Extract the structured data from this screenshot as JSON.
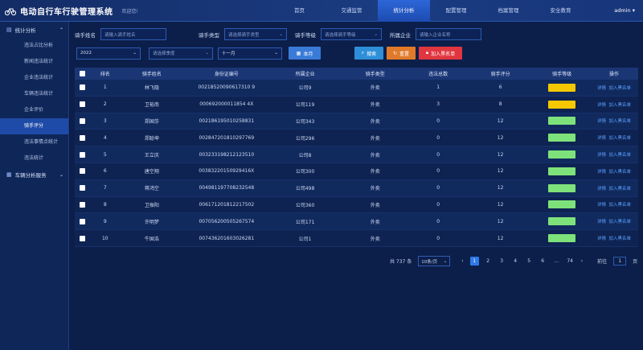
{
  "app": {
    "title": "电动自行车行驶管理系统",
    "welcome": "欢迎您!"
  },
  "nav": [
    "首页",
    "交通监管",
    "统计分析",
    "配置管理",
    "档案管理",
    "安全教育"
  ],
  "nav_active": 2,
  "user": "admin ▾",
  "sidebar": {
    "group1": "统计分析",
    "items": [
      "违法占比分析",
      "新闻违法统计",
      "企业违法统计",
      "车辆违法统计",
      "企业评价",
      "骑手评分",
      "违法事情点统计",
      "违法统计"
    ],
    "active_index": 5,
    "group2": "车辆分析服务"
  },
  "filters": {
    "rider_name_label": "骑手姓名",
    "rider_name_ph": "请输入骑手姓名",
    "rider_type_label": "骑手类型",
    "rider_type_ph": "请选择骑手类型",
    "rider_level_label": "骑手等级",
    "rider_level_ph": "请选择骑手等级",
    "company_label": "所属企业",
    "company_ph": "请输入企业名称",
    "year": "2022",
    "quarter_ph": "请选择季度",
    "month": "十一月",
    "this_month": "本月",
    "search": "搜索",
    "reset": "重置",
    "blacklist": "加入黑名单"
  },
  "table": {
    "headers": [
      "排名",
      "骑手姓名",
      "身份证编号",
      "所属企业",
      "骑手类型",
      "违法总数",
      "骑手评分",
      "骑手等级",
      "操作"
    ],
    "op_detail": "详情",
    "op_black": "加入黑名单",
    "rows": [
      {
        "rank": "1",
        "name": "林飞隐",
        "id": "00218520090617310 9",
        "company": "公司9",
        "type": "外卖",
        "violations": "1",
        "score": "6",
        "level": "yellow"
      },
      {
        "rank": "2",
        "name": "卫裕南",
        "id": "000692000011854 4X",
        "company": "公司119",
        "type": "外卖",
        "violations": "3",
        "score": "8",
        "level": "yellow"
      },
      {
        "rank": "3",
        "name": "郑国莎",
        "id": "002186195010258831",
        "company": "公司343",
        "type": "外卖",
        "violations": "0",
        "score": "12",
        "level": "green"
      },
      {
        "rank": "4",
        "name": "郑聪坤",
        "id": "002847201810297769",
        "company": "公司296",
        "type": "外卖",
        "violations": "0",
        "score": "12",
        "level": "green"
      },
      {
        "rank": "5",
        "name": "王立庆",
        "id": "003233198212123510",
        "company": "公司8",
        "type": "外卖",
        "violations": "0",
        "score": "12",
        "level": "green"
      },
      {
        "rank": "6",
        "name": "唐空翔",
        "id": "00383220150929416X",
        "company": "公司300",
        "type": "外卖",
        "violations": "0",
        "score": "12",
        "level": "green"
      },
      {
        "rank": "7",
        "name": "蒋鸿空",
        "id": "004981197708232548",
        "company": "公司498",
        "type": "外卖",
        "violations": "0",
        "score": "12",
        "level": "green"
      },
      {
        "rank": "8",
        "name": "卫振阳",
        "id": "006171201812217502",
        "company": "公司360",
        "type": "外卖",
        "violations": "0",
        "score": "12",
        "level": "green"
      },
      {
        "rank": "9",
        "name": "许明梦",
        "id": "007056200505267574",
        "company": "公司171",
        "type": "外卖",
        "violations": "0",
        "score": "12",
        "level": "green"
      },
      {
        "rank": "10",
        "name": "牛国浩",
        "id": "007436201603026281",
        "company": "公司1",
        "type": "外卖",
        "violations": "0",
        "score": "12",
        "level": "green"
      }
    ]
  },
  "pager": {
    "total": "共 737 条",
    "page_size": "10条/页",
    "pages": [
      "1",
      "2",
      "3",
      "4",
      "5",
      "6",
      "…",
      "74"
    ],
    "goto_label": "前往",
    "goto_value": "1",
    "page_suffix": "页"
  },
  "colors": {
    "yellow": "#f5c800",
    "green": "#7ee27a"
  }
}
